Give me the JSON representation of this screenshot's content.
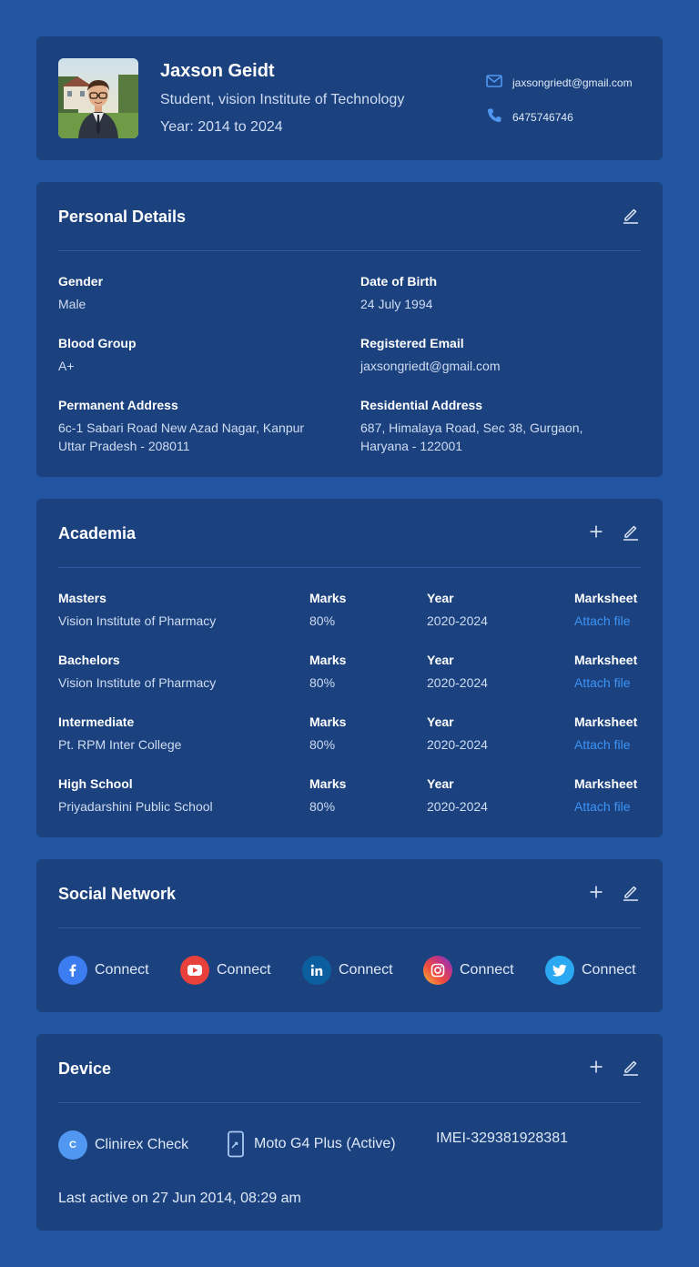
{
  "profile": {
    "name": "Jaxson Geidt",
    "subtitle": "Student, vision Institute of Technology",
    "year": "Year: 2014 to 2024",
    "email": "jaxsongriedt@gmail.com",
    "phone": "6475746746"
  },
  "personal": {
    "title": "Personal Details",
    "fields": [
      {
        "label": "Gender",
        "value": "Male"
      },
      {
        "label": "Date of Birth",
        "value": "24 July 1994"
      },
      {
        "label": "Blood Group",
        "value": "A+"
      },
      {
        "label": "Registered Email",
        "value": "jaxsongriedt@gmail.com"
      },
      {
        "label": "Permanent Address",
        "line1": "6c-1 Sabari Road New Azad Nagar, Kanpur",
        "line2": "Uttar Pradesh - 208011"
      },
      {
        "label": "Residential Address",
        "line1": "687, Himalaya Road, Sec 38, Gurgaon,",
        "line2": "Haryana - 122001"
      }
    ]
  },
  "academia": {
    "title": "Academia",
    "rows": [
      {
        "level": "Masters",
        "institute": "Vision Institute of Pharmacy",
        "marks_label": "Marks",
        "marks": "80%",
        "year_label": "Year",
        "year": "2020-2024",
        "sheet_label": "Marksheet",
        "sheet_link": "Attach file"
      },
      {
        "level": "Bachelors",
        "institute": "Vision Institute of Pharmacy",
        "marks_label": "Marks",
        "marks": "80%",
        "year_label": "Year",
        "year": "2020-2024",
        "sheet_label": "Marksheet",
        "sheet_link": "Attach file"
      },
      {
        "level": "Intermediate",
        "institute": "Pt. RPM Inter College",
        "marks_label": "Marks",
        "marks": "80%",
        "year_label": "Year",
        "year": "2020-2024",
        "sheet_label": "Marksheet",
        "sheet_link": "Attach file"
      },
      {
        "level": "High School",
        "institute": "Priyadarshini Public School",
        "marks_label": "Marks",
        "marks": "80%",
        "year_label": "Year",
        "year": "2020-2024",
        "sheet_label": "Marksheet",
        "sheet_link": "Attach file"
      }
    ]
  },
  "social": {
    "title": "Social Network",
    "items": [
      {
        "icon": "facebook-icon",
        "label": "Connect",
        "color": "#3b7cf0"
      },
      {
        "icon": "youtube-icon",
        "label": "Connect",
        "color": "#e8413c"
      },
      {
        "icon": "linkedin-icon",
        "label": "Connect",
        "color": "#0b5f9f"
      },
      {
        "icon": "instagram-icon",
        "label": "Connect",
        "color": "#c13584"
      },
      {
        "icon": "twitter-icon",
        "label": "Connect",
        "color": "#2aa8f2"
      }
    ]
  },
  "device": {
    "title": "Device",
    "app_initial": "C",
    "app_name": "Clinirex Check",
    "device_name": "Moto G4 Plus (Active)",
    "imei": "IMEI-329381928381",
    "last_active": "Last active on 27 Jun 2014, 08:29 am"
  },
  "colors": {
    "background": "#2354a1",
    "card": "#1b427f",
    "link": "#3d94f5",
    "icon_blue": "#4f97f0"
  }
}
